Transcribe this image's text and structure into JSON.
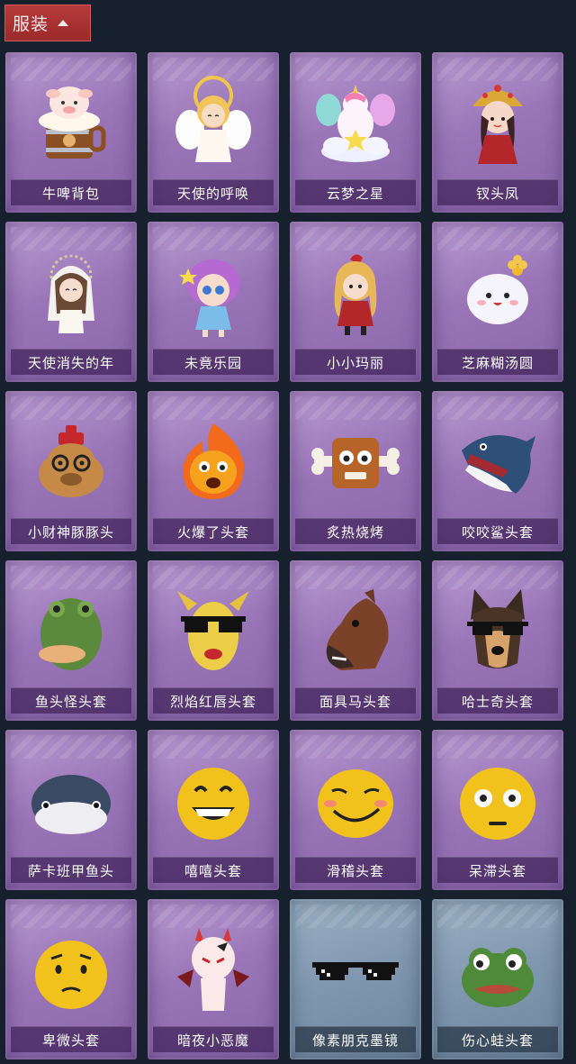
{
  "header": {
    "title": "服装",
    "toggle_icon": "chevron-up-icon"
  },
  "items": [
    {
      "name": "牛啤背包",
      "icon": "cow-beer-bag-icon",
      "frame": "purple"
    },
    {
      "name": "天使的呼唤",
      "icon": "angel-call-icon",
      "frame": "purple"
    },
    {
      "name": "云梦之星",
      "icon": "unicorn-cloud-star-icon",
      "frame": "purple"
    },
    {
      "name": "钗头凤",
      "icon": "phoenix-crown-girl-icon",
      "frame": "purple"
    },
    {
      "name": "天使消失的年",
      "icon": "veiled-angel-icon",
      "frame": "purple"
    },
    {
      "name": "未竟乐园",
      "icon": "purple-hair-doll-icon",
      "frame": "purple"
    },
    {
      "name": "小小玛丽",
      "icon": "little-mary-doll-icon",
      "frame": "purple"
    },
    {
      "name": "芝麻糊汤圆",
      "icon": "rice-ball-icon",
      "frame": "purple"
    },
    {
      "name": "小财神豚豚头",
      "icon": "capybara-head-icon",
      "frame": "purple"
    },
    {
      "name": "火爆了头套",
      "icon": "fire-head-icon",
      "frame": "purple"
    },
    {
      "name": "炙热烧烤",
      "icon": "bbq-meat-icon",
      "frame": "purple"
    },
    {
      "name": "咬咬鲨头套",
      "icon": "shark-head-icon",
      "frame": "purple"
    },
    {
      "name": "鱼头怪头套",
      "icon": "fish-monster-head-icon",
      "frame": "purple"
    },
    {
      "name": "烈焰红唇头套",
      "icon": "yellow-lips-mask-icon",
      "frame": "purple"
    },
    {
      "name": "面具马头套",
      "icon": "horse-head-icon",
      "frame": "purple"
    },
    {
      "name": "哈士奇头套",
      "icon": "husky-head-icon",
      "frame": "purple"
    },
    {
      "name": "萨卡班甲鱼头",
      "icon": "sacabambaspis-icon",
      "frame": "purple"
    },
    {
      "name": "嘻嘻头套",
      "icon": "grin-emoji-head-icon",
      "frame": "purple"
    },
    {
      "name": "滑稽头套",
      "icon": "funny-emoji-head-icon",
      "frame": "purple"
    },
    {
      "name": "呆滞头套",
      "icon": "blank-stare-emoji-head-icon",
      "frame": "purple"
    },
    {
      "name": "卑微头套",
      "icon": "humble-emoji-head-icon",
      "frame": "purple"
    },
    {
      "name": "暗夜小恶魔",
      "icon": "little-devil-icon",
      "frame": "purple"
    },
    {
      "name": "像素朋克墨镜",
      "icon": "pixel-sunglasses-icon",
      "frame": "blue"
    },
    {
      "name": "伤心蛙头套",
      "icon": "sad-frog-head-icon",
      "frame": "blue"
    }
  ]
}
